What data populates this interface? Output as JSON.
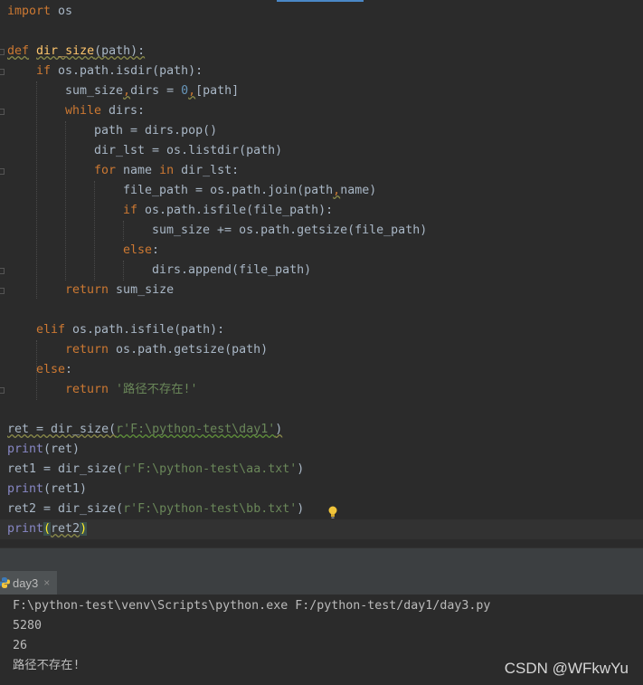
{
  "editor": {
    "lines": {
      "l1": {
        "kw_import": "import",
        "mod": " os"
      },
      "l3": {
        "kw_def": "def",
        "fn_name": "dir_size",
        "rest": "(path):"
      },
      "l4": {
        "kw_if": "if",
        "rest": " os.path.isdir(path):"
      },
      "l5": {
        "a": "sum_size",
        "b": "dirs = ",
        "num": "0",
        "c": "[path]"
      },
      "l6": {
        "kw": "while",
        "rest": " dirs:"
      },
      "l7": {
        "text": "path = dirs.pop()"
      },
      "l8": {
        "text": "dir_lst = os.listdir(path)"
      },
      "l9": {
        "kw_for": "for",
        "mid": " name ",
        "kw_in": "in",
        "rest": " dir_lst:"
      },
      "l10": {
        "a": "file_path = os.path.join(path",
        "b": "name)"
      },
      "l11": {
        "kw": "if",
        "rest": " os.path.isfile(file_path):"
      },
      "l12": {
        "text": "sum_size += os.path.getsize(file_path)"
      },
      "l13": {
        "kw": "else",
        "rest": ":"
      },
      "l14": {
        "text": "dirs.append(file_path)"
      },
      "l15": {
        "kw": "return",
        "rest": " sum_size"
      },
      "l17": {
        "kw": "elif",
        "rest": " os.path.isfile(path):"
      },
      "l18": {
        "kw": "return",
        "rest": " os.path.getsize(path)"
      },
      "l19": {
        "kw": "else",
        "rest": ":"
      },
      "l20": {
        "kw": "return",
        "str": " '路径不存在!'"
      },
      "l22": {
        "a": "ret = dir_size(",
        "str": "r'F:\\python-test\\day1'",
        "b": ")"
      },
      "l23": {
        "bi": "print",
        "rest": "(ret)"
      },
      "l24": {
        "a": "ret1 = dir_size(",
        "str": "r'F:\\python-test\\aa.txt'",
        "b": ")"
      },
      "l25": {
        "bi": "print",
        "rest": "(ret1)"
      },
      "l26": {
        "a": "ret2 = dir_size(",
        "str": "r'F:\\python-test\\bb.txt'",
        "b": ")"
      },
      "l27": {
        "bi": "print",
        "open": "(",
        "arg": "ret2",
        "close": ")"
      }
    },
    "comma": ","
  },
  "run_panel": {
    "tab_label": "day3",
    "close_glyph": "×",
    "output": [
      "F:\\python-test\\venv\\Scripts\\python.exe F:/python-test/day1/day3.py",
      "5280",
      "26",
      "路径不存在!"
    ]
  },
  "watermark": "CSDN @WFkwYu",
  "colors": {
    "keyword": "#cc7832",
    "function": "#ffc66d",
    "string": "#6a8759",
    "number": "#6897bb",
    "builtin": "#8888c6"
  }
}
